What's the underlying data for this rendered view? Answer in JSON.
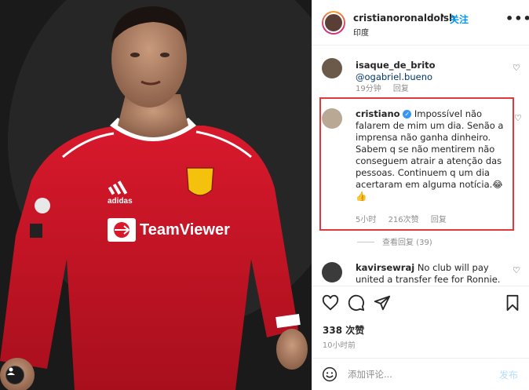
{
  "photo": {
    "jersey_brand": "TeamViewer",
    "kit_brand": "adidas"
  },
  "header": {
    "username": "cristianoronaldoish",
    "separator": "•",
    "follow_label": "关注",
    "location": "印度",
    "more_icon": "more-horizontal-icon"
  },
  "comments": [
    {
      "username": "isaque_de_brito",
      "mention": "@ogabriel.bueno",
      "time": "19分钟",
      "reply_label": "回复"
    },
    {
      "username": "cristiano",
      "verified": true,
      "text": "Impossível não falarem de mim um dia. Senão a imprensa não ganha dinheiro. Sabem q se não mentirem não conseguem atrair a atenção das pessoas. Continuem q um dia acertaram em alguma notícia.😂👍",
      "time": "5小时",
      "likes": "216次赞",
      "reply_label": "回复",
      "view_replies": "查看回复 (39)"
    },
    {
      "username": "kavirsewraj",
      "text": "No club will pay united a transfer fee for Ronnie."
    }
  ],
  "actions": {
    "like_icon": "heart-icon",
    "comment_icon": "comment-icon",
    "share_icon": "send-icon",
    "save_icon": "bookmark-icon",
    "likes_count": "338 次赞",
    "posted_time": "10小时前"
  },
  "add_comment": {
    "placeholder": "添加评论...",
    "post_label": "发布"
  },
  "colors": {
    "accent_blue": "#0095f6",
    "highlight_red": "#e0383b",
    "muted": "#8e8e8e"
  }
}
